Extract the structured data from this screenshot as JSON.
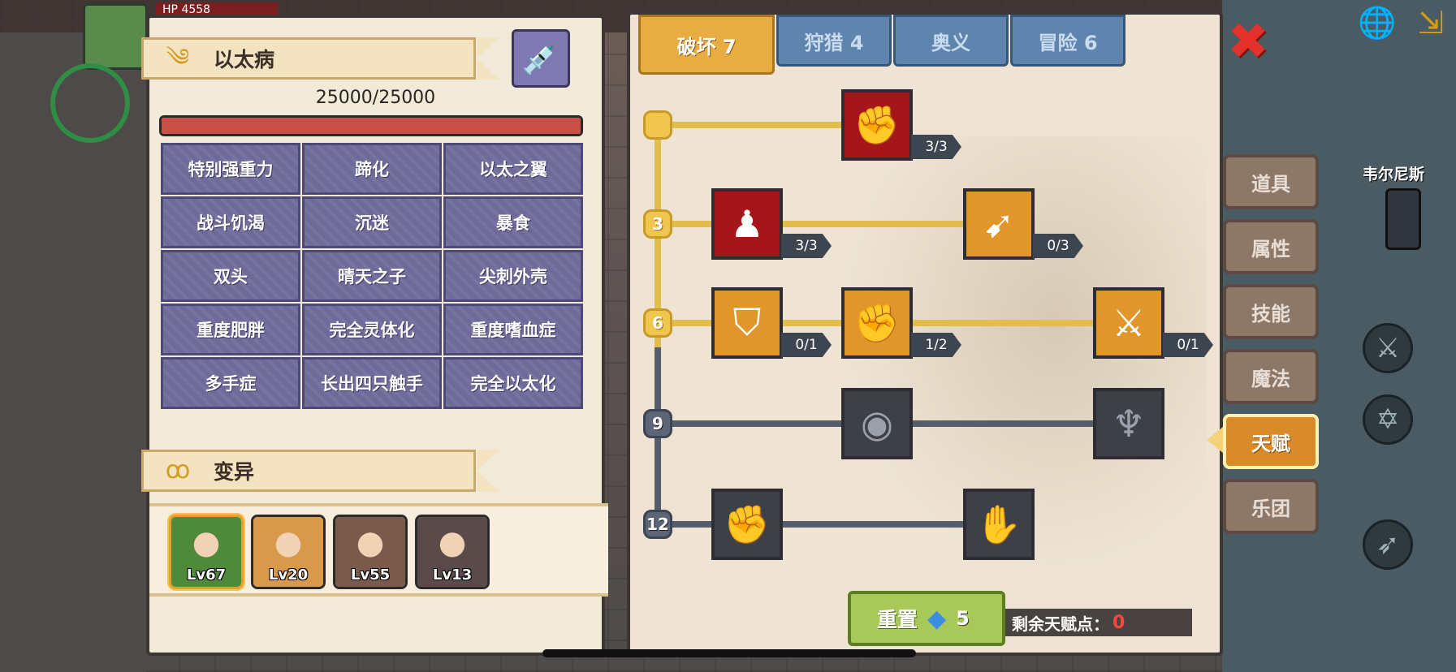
{
  "hud": {
    "hp_label": "HP",
    "hp_value": "4558",
    "npc_name": "韦尔尼斯"
  },
  "disease": {
    "title": "以太病",
    "icon": "wind-icon",
    "hp_current": 25000,
    "hp_max": 25000,
    "hp_text": "25000/25000",
    "hp_fill_fraction": 1.0,
    "traits": [
      "特别强重力",
      "蹄化",
      "以太之翼",
      "战斗饥渴",
      "沉迷",
      "暴食",
      "双头",
      "晴天之子",
      "尖刺外壳",
      "重度肥胖",
      "完全灵体化",
      "重度嗜血症",
      "多手症",
      "长出四只触手",
      "完全以太化"
    ]
  },
  "mutation": {
    "title": "变异",
    "icon": "dna-icon"
  },
  "party": [
    {
      "name": "character-1",
      "level": "Lv67",
      "color": "#4f8a3a",
      "active": true
    },
    {
      "name": "character-2",
      "level": "Lv20",
      "color": "#d89a4a",
      "active": false
    },
    {
      "name": "character-3",
      "level": "Lv55",
      "color": "#7a5a4a",
      "active": false
    },
    {
      "name": "character-4",
      "level": "Lv13",
      "color": "#5a4a4a",
      "active": false
    }
  ],
  "talent_tabs": [
    {
      "label": "破坏 7",
      "active": true
    },
    {
      "label": "狩猎 4",
      "active": false
    },
    {
      "label": "奥义",
      "active": false
    },
    {
      "label": "冒险 6",
      "active": false
    }
  ],
  "talent_tree": {
    "levels": [
      {
        "label": "",
        "active": true
      },
      {
        "label": "3",
        "active": true
      },
      {
        "label": "6",
        "active": true
      },
      {
        "label": "9",
        "active": false
      },
      {
        "label": "12",
        "active": false
      }
    ],
    "skills": [
      {
        "icon": "arm-wrestle-icon",
        "style": "red",
        "count": "3/3"
      },
      {
        "icon": "muscle-body-icon",
        "style": "red",
        "count": "3/3"
      },
      {
        "icon": "arrow-dodge-icon",
        "style": "orange",
        "count": "0/3"
      },
      {
        "icon": "shield-break-icon",
        "style": "orange",
        "count": "0/1"
      },
      {
        "icon": "punch-icon",
        "style": "orange",
        "count": "1/2"
      },
      {
        "icon": "sword-slash-icon",
        "style": "orange",
        "count": "0/1"
      },
      {
        "icon": "ripple-orb-icon",
        "style": "dark",
        "count": ""
      },
      {
        "icon": "bat-drop-icon",
        "style": "dark",
        "count": ""
      },
      {
        "icon": "fist-icon",
        "style": "dark",
        "count": ""
      },
      {
        "icon": "grab-hand-icon",
        "style": "dark",
        "count": ""
      }
    ]
  },
  "reset": {
    "label": "重置",
    "cost": "5",
    "icon": "diamond-icon"
  },
  "remaining_points": {
    "label": "剩余天赋点：",
    "value": "0"
  },
  "side_menu": [
    {
      "label": "道具",
      "active": false
    },
    {
      "label": "属性",
      "active": false
    },
    {
      "label": "技能",
      "active": false
    },
    {
      "label": "魔法",
      "active": false
    },
    {
      "label": "天赋",
      "active": true
    },
    {
      "label": "乐团",
      "active": false
    }
  ],
  "colors": {
    "hp_bar": "#c95045",
    "active_tab": "#e8ad42",
    "inactive_tab": "#5f84ad",
    "active_menu": "#d98b2a",
    "tree_active": "#e2bd4d",
    "remaining_points_value": "#ff3b30"
  }
}
